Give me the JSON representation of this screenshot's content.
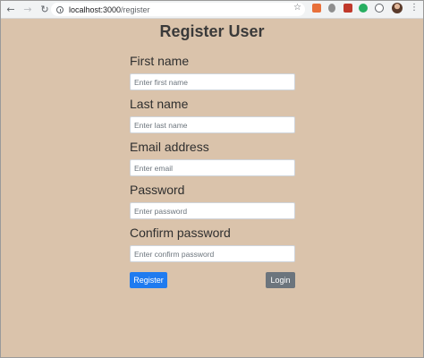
{
  "browser": {
    "url_host": "localhost:3000",
    "url_path": "/register",
    "back_glyph": "←",
    "forward_glyph": "→",
    "reload_glyph": "↻",
    "star_glyph": "☆",
    "menu_glyph": "⋮"
  },
  "page": {
    "title": "Register User"
  },
  "form": {
    "fields": [
      {
        "label": "First name",
        "placeholder": "Enter first name",
        "value": ""
      },
      {
        "label": "Last name",
        "placeholder": "Enter last name",
        "value": ""
      },
      {
        "label": "Email address",
        "placeholder": "Enter email",
        "value": ""
      },
      {
        "label": "Password",
        "placeholder": "Enter password",
        "value": ""
      },
      {
        "label": "Confirm password",
        "placeholder": "Enter confirm password",
        "value": ""
      }
    ],
    "register_label": "Register",
    "login_label": "Login"
  },
  "colors": {
    "page_background": "#dac3ab",
    "register_button": "#1f7bf0",
    "login_button": "#6c757d"
  },
  "icons": [
    "back-arrow-icon",
    "forward-arrow-icon",
    "reload-icon",
    "site-info-icon",
    "bookmark-star-icon",
    "extension-icon",
    "profile-avatar",
    "browser-menu-icon"
  ]
}
